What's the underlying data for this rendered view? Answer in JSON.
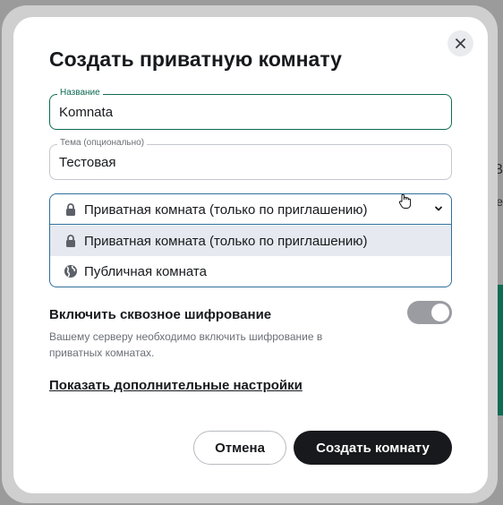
{
  "background": {
    "fragment_1": "В",
    "fragment_2": "е"
  },
  "dialog": {
    "title": "Создать приватную комнату",
    "close_icon": "close-icon"
  },
  "name_field": {
    "label": "Название",
    "value": "Komnata"
  },
  "topic_field": {
    "label": "Тема (опционально)",
    "value": "Тестовая"
  },
  "visibility": {
    "selected_label": "Приватная комната (только по приглашению)",
    "options": [
      {
        "label": "Приватная комната (только по приглашению)",
        "icon": "lock-icon"
      },
      {
        "label": "Публичная комната",
        "icon": "globe-icon"
      }
    ]
  },
  "encryption": {
    "title": "Включить сквозное шифрование",
    "description": "Вашему серверу необходимо включить шифрование в приватных комнатах.",
    "enabled": true
  },
  "advanced_link": "Показать дополнительные настройки",
  "buttons": {
    "cancel": "Отмена",
    "create": "Создать комнату"
  },
  "colors": {
    "accent_green": "#0f6b52",
    "primary_button": "#17191c"
  }
}
